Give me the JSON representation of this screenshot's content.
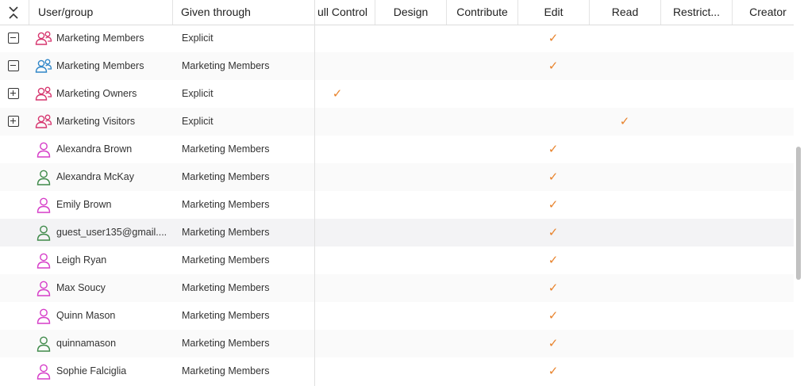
{
  "header": {
    "user_group": "User/group",
    "given_through": "Given through",
    "permissions": [
      "ull Control",
      "Design",
      "Contribute",
      "Edit",
      "Read",
      "Restrict...",
      "Creator"
    ]
  },
  "colors": {
    "check": "#e8832c",
    "group_pink": "#d6356e",
    "group_blue": "#2f86c8",
    "user_pink": "#d63dc8",
    "user_green": "#3f8a4a"
  },
  "rows": [
    {
      "name": "Marketing Members",
      "given": "Explicit",
      "expander": "minus",
      "icon": "group-icon",
      "color": "group_pink",
      "perm": "Edit"
    },
    {
      "name": "Marketing Members",
      "given": "Marketing Members",
      "expander": "minus",
      "icon": "group-icon",
      "color": "group_blue",
      "perm": "Edit"
    },
    {
      "name": "Marketing Owners",
      "given": "Explicit",
      "expander": "plus",
      "icon": "group-icon",
      "color": "group_pink",
      "perm": "Full Control"
    },
    {
      "name": "Marketing Visitors",
      "given": "Explicit",
      "expander": "plus",
      "icon": "group-icon",
      "color": "group_pink",
      "perm": "Read"
    },
    {
      "name": "Alexandra Brown",
      "given": "Marketing Members",
      "expander": "",
      "icon": "user-icon",
      "color": "user_pink",
      "perm": "Edit"
    },
    {
      "name": "Alexandra McKay",
      "given": "Marketing Members",
      "expander": "",
      "icon": "user-icon",
      "color": "user_green",
      "perm": "Edit"
    },
    {
      "name": "Emily Brown",
      "given": "Marketing Members",
      "expander": "",
      "icon": "user-icon",
      "color": "user_pink",
      "perm": "Edit"
    },
    {
      "name": "guest_user135@gmail....",
      "given": "Marketing Members",
      "expander": "",
      "icon": "user-icon",
      "color": "user_green",
      "perm": "Edit"
    },
    {
      "name": "Leigh Ryan",
      "given": "Marketing Members",
      "expander": "",
      "icon": "user-icon",
      "color": "user_pink",
      "perm": "Edit"
    },
    {
      "name": "Max Soucy",
      "given": "Marketing Members",
      "expander": "",
      "icon": "user-icon",
      "color": "user_pink",
      "perm": "Edit"
    },
    {
      "name": "Quinn Mason",
      "given": "Marketing Members",
      "expander": "",
      "icon": "user-icon",
      "color": "user_pink",
      "perm": "Edit"
    },
    {
      "name": "quinnamason",
      "given": "Marketing Members",
      "expander": "",
      "icon": "user-icon",
      "color": "user_green",
      "perm": "Edit"
    },
    {
      "name": "Sophie Falciglia",
      "given": "Marketing Members",
      "expander": "",
      "icon": "user-icon",
      "color": "user_pink",
      "perm": "Edit"
    }
  ],
  "check_glyph": "✓"
}
